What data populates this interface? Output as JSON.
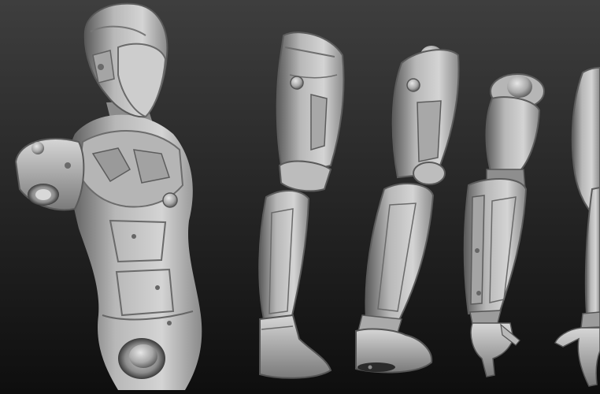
{
  "scene": {
    "background_top": "#3c3c3c",
    "background_bottom": "#101010",
    "material_light": "#c9c9c9",
    "material_mid": "#9a9a9a",
    "material_dark": "#565656",
    "parts": [
      {
        "name": "torso-helmet"
      },
      {
        "name": "leg-side"
      },
      {
        "name": "leg-three-quarter"
      },
      {
        "name": "arm-front"
      },
      {
        "name": "arm-edge-cropped"
      }
    ]
  }
}
